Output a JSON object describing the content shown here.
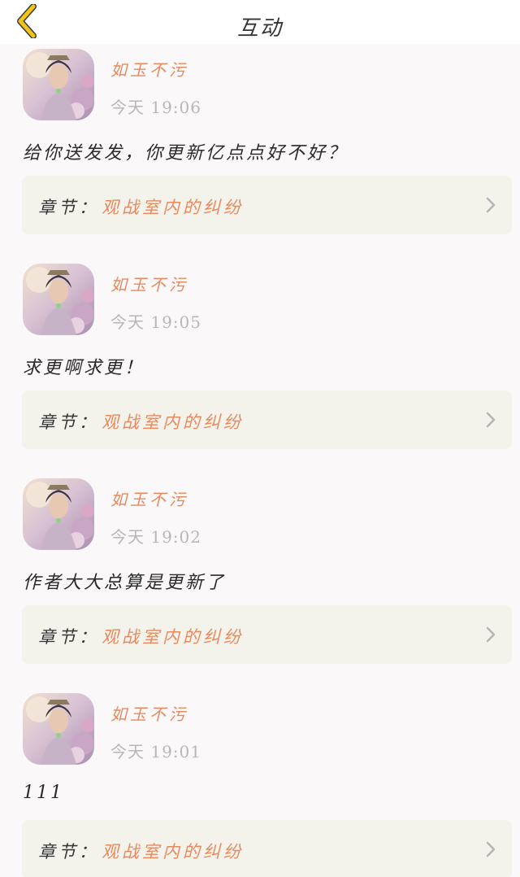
{
  "header": {
    "title": "互动",
    "back_icon": "chevron-left-icon",
    "back_color": "#f0c419"
  },
  "posts": [
    {
      "username": "如玉不污",
      "time": "今天 19:06",
      "comment": "给你送发发，你更新亿点点好不好？",
      "chapter_label": "章节：",
      "chapter_title": "观战室内的纠纷"
    },
    {
      "username": "如玉不污",
      "time": "今天 19:05",
      "comment": "求更啊求更！",
      "chapter_label": "章节：",
      "chapter_title": "观战室内的纠纷"
    },
    {
      "username": "如玉不污",
      "time": "今天 19:02",
      "comment": "作者大大总算是更新了",
      "chapter_label": "章节：",
      "chapter_title": "观战室内的纠纷"
    },
    {
      "username": "如玉不污",
      "time": "今天 19:01",
      "comment": "111",
      "chapter_label": "章节：",
      "chapter_title": "观战室内的纠纷"
    }
  ],
  "colors": {
    "accent": "#e48a5e",
    "muted": "#b8b6b6",
    "card_bg": "#f3f3ec"
  }
}
